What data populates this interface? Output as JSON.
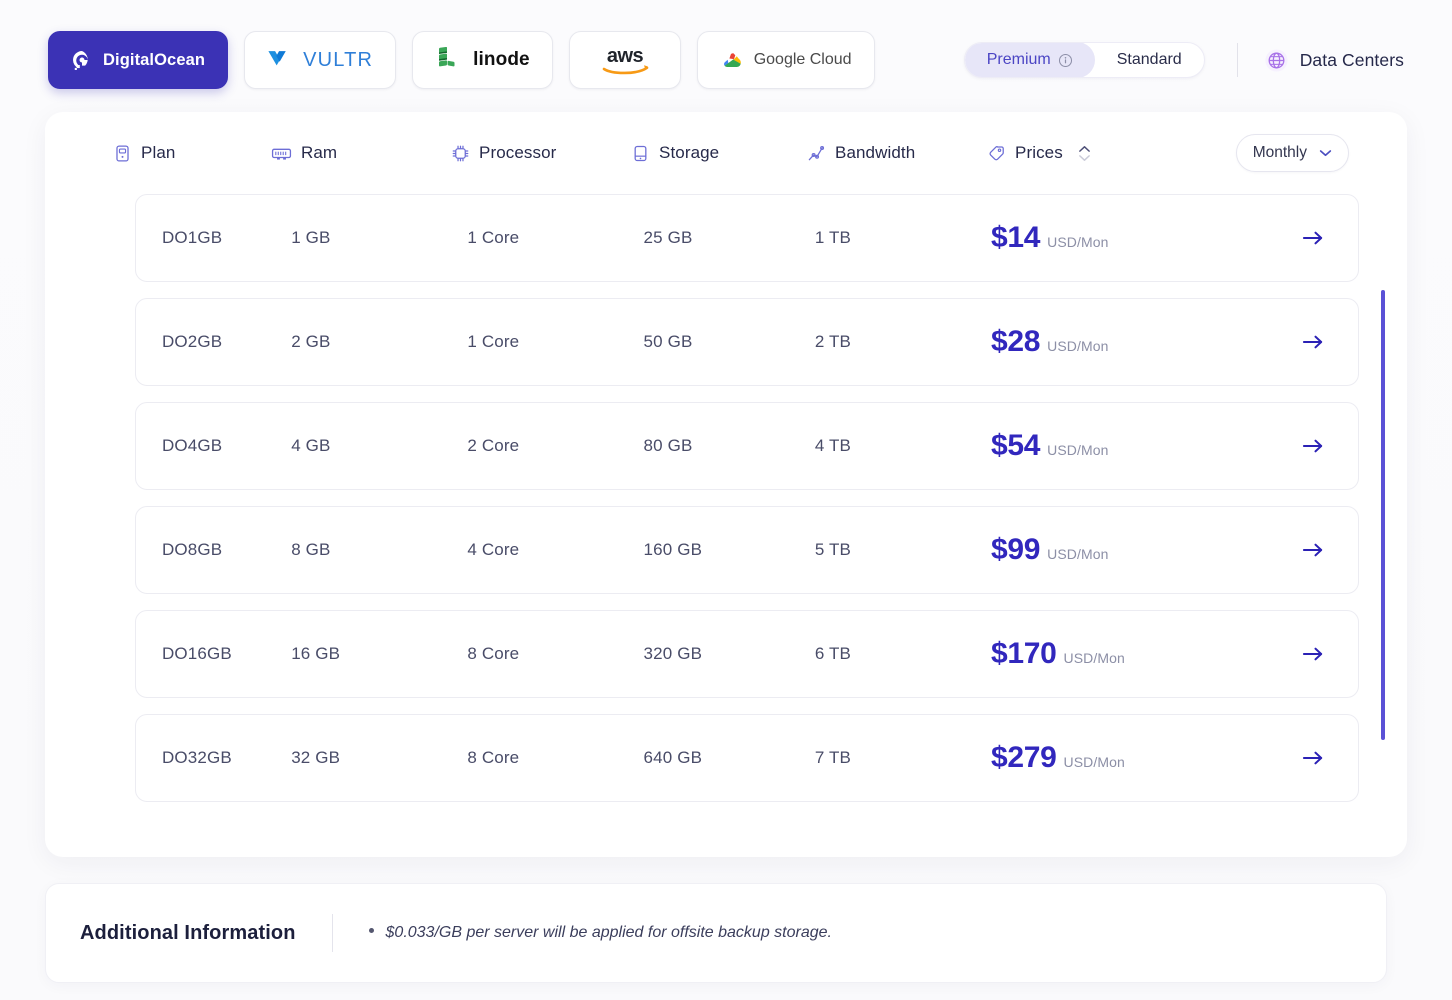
{
  "providers": [
    {
      "name": "DigitalOcean",
      "label": "DigitalOcean",
      "icon": "digitalocean-logo",
      "active": true
    },
    {
      "name": "Vultr",
      "label": "VULTR",
      "icon": "vultr-logo",
      "active": false
    },
    {
      "name": "Linode",
      "label": "linode",
      "icon": "linode-logo",
      "active": false
    },
    {
      "name": "AWS",
      "label": "aws",
      "icon": "aws-logo",
      "active": false
    },
    {
      "name": "GoogleCloud",
      "label": "Google Cloud",
      "icon": "google-cloud-logo",
      "active": false
    }
  ],
  "tier_toggle": {
    "premium_label": "Premium",
    "standard_label": "Standard",
    "selected": "Premium",
    "info_icon": "info-icon"
  },
  "data_centers": {
    "label": "Data Centers",
    "icon": "globe-icon"
  },
  "table": {
    "columns": [
      {
        "key": "plan",
        "label": "Plan",
        "icon": "server-icon"
      },
      {
        "key": "ram",
        "label": "Ram",
        "icon": "memory-icon"
      },
      {
        "key": "processor",
        "label": "Processor",
        "icon": "cpu-icon"
      },
      {
        "key": "storage",
        "label": "Storage",
        "icon": "hard-drive-icon"
      },
      {
        "key": "bandwidth",
        "label": "Bandwidth",
        "icon": "activity-icon"
      },
      {
        "key": "prices",
        "label": "Prices",
        "icon": "tag-icon",
        "sortable": true
      }
    ],
    "period_select": {
      "value": "Monthly",
      "chevron_icon": "chevron-down-icon"
    },
    "row_action_icon": "arrow-right-icon",
    "price_unit": "USD/Mon",
    "rows": [
      {
        "plan": "DO1GB",
        "ram": "1 GB",
        "processor": "1 Core",
        "storage": "25 GB",
        "bandwidth": "1 TB",
        "price": "$14",
        "price_unit": "USD/Mon"
      },
      {
        "plan": "DO2GB",
        "ram": "2 GB",
        "processor": "1 Core",
        "storage": "50 GB",
        "bandwidth": "2 TB",
        "price": "$28",
        "price_unit": "USD/Mon"
      },
      {
        "plan": "DO4GB",
        "ram": "4 GB",
        "processor": "2 Core",
        "storage": "80 GB",
        "bandwidth": "4 TB",
        "price": "$54",
        "price_unit": "USD/Mon"
      },
      {
        "plan": "DO8GB",
        "ram": "8 GB",
        "processor": "4 Core",
        "storage": "160 GB",
        "bandwidth": "5 TB",
        "price": "$99",
        "price_unit": "USD/Mon"
      },
      {
        "plan": "DO16GB",
        "ram": "16 GB",
        "processor": "8 Core",
        "storage": "320 GB",
        "bandwidth": "6 TB",
        "price": "$170",
        "price_unit": "USD/Mon"
      },
      {
        "plan": "DO32GB",
        "ram": "32 GB",
        "processor": "8 Core",
        "storage": "640 GB",
        "bandwidth": "7 TB",
        "price": "$279",
        "price_unit": "USD/Mon"
      }
    ]
  },
  "additional_information": {
    "title": "Additional Information",
    "items": [
      "$0.033/GB per server will be applied for offsite backup storage."
    ]
  },
  "colors": {
    "accent": "#3b32b5",
    "price": "#3127bd",
    "toggle_active_bg": "#e7e6f8",
    "toggle_active_text": "#4b45c4",
    "scrollbar": "#5a51d6",
    "page_bg": "#fbfbfd",
    "card_bg": "#ffffff"
  }
}
